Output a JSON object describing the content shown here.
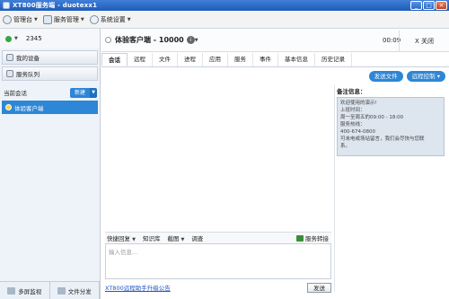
{
  "window": {
    "title": "XT800服务端 - duotexx1"
  },
  "menubar": {
    "items": [
      {
        "label": "管理台",
        "icon": "console-icon"
      },
      {
        "label": "服务管理",
        "icon": "service-icon"
      },
      {
        "label": "系统设置",
        "icon": "settings-icon"
      }
    ]
  },
  "left": {
    "status_number": "2345",
    "my_devices": "我的设备",
    "service_queue": "服务队列",
    "current_sessions": "当前会话",
    "new_button": "新建",
    "session_name": "体验客户端",
    "bottom_left": "多屏监视",
    "bottom_right": "文件分发"
  },
  "conversation": {
    "title": "体验客户端 - 10000",
    "timer": "00:09",
    "close_label": "X 关闭"
  },
  "tabs": [
    "会话",
    "远程",
    "文件",
    "进程",
    "应用",
    "服务",
    "事件",
    "基本信息",
    "历史记录"
  ],
  "actions": {
    "send_file": "发送文件",
    "remote_control": "远程控制"
  },
  "notice": {
    "title": "备注信息：",
    "lines": [
      "欢迎使用的演示!",
      "上班时间：",
      "周一至周五的09:00 - 18:00",
      "服务热线：",
      "400-674-0800",
      "可未电或场站留言，我们会尽快与您联",
      "系。"
    ]
  },
  "toolbar": {
    "quick_reply": "快捷回复",
    "knowledge": "知识库",
    "screenshot": "截图",
    "survey": "调查",
    "service_transfer": "服务转接"
  },
  "input": {
    "placeholder": "输入信息..."
  },
  "bottom": {
    "link": "XT800远程助手升级公告",
    "send": "发送"
  },
  "colors": {
    "accent": "#2d86d6",
    "title_bar": "#1f5bb8"
  }
}
